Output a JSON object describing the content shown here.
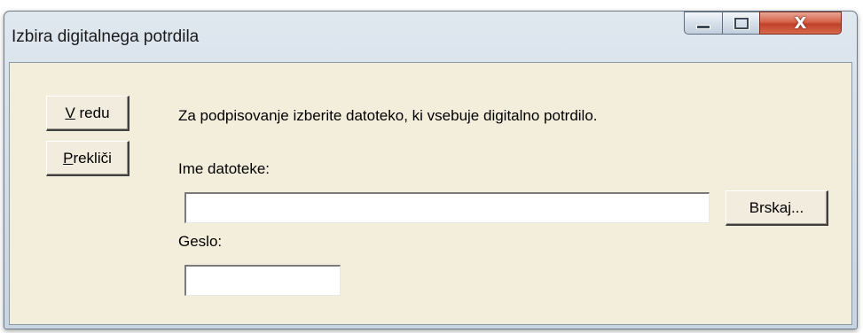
{
  "window": {
    "title": "Izbira digitalnega potrdila"
  },
  "titlebar_controls": {
    "minimize_icon": "minimize-icon",
    "maximize_icon": "maximize-icon",
    "close_icon": "close-icon",
    "close_glyph": "X"
  },
  "buttons": {
    "ok": {
      "mnemonic": "V",
      "rest": " redu"
    },
    "cancel": {
      "mnemonic": "P",
      "rest": "rekliči"
    },
    "browse": "Brskaj..."
  },
  "instruction": "Za podpisovanje izberite datoteko, ki vsebuje digitalno potrdilo.",
  "file_field": {
    "label": "Ime datoteke:",
    "value": ""
  },
  "password_field": {
    "label": "Geslo:",
    "value": ""
  },
  "colors": {
    "client_background": "#f3eedc",
    "close_button": "#c1402a"
  }
}
